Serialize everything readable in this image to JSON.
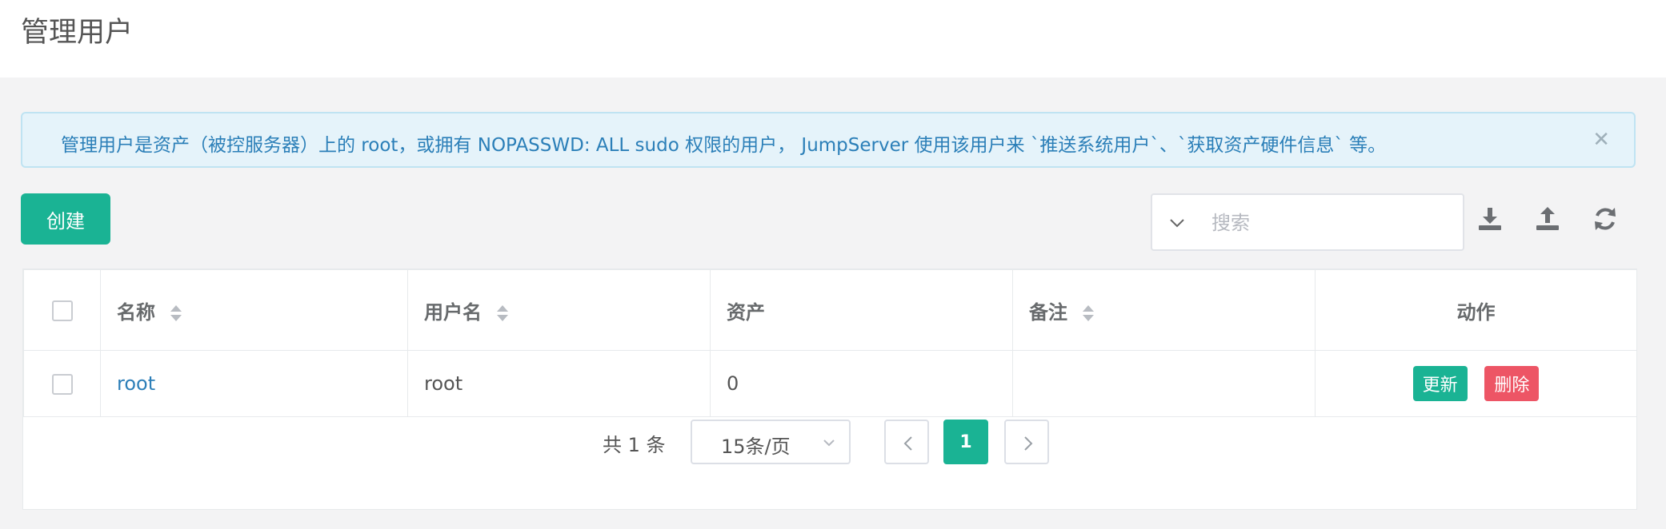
{
  "header": {
    "title": "管理用户"
  },
  "alert": {
    "text": "管理用户是资产（被控服务器）上的 root，或拥有 NOPASSWD: ALL sudo 权限的用户， JumpServer 使用该用户来 `推送系统用户`、`获取资产硬件信息` 等。",
    "close_icon": "close-icon"
  },
  "toolbar": {
    "create_label": "创建",
    "search_placeholder": "搜索",
    "icons": [
      "download-icon",
      "upload-icon",
      "refresh-icon"
    ]
  },
  "table": {
    "columns": [
      "名称",
      "用户名",
      "资产",
      "备注",
      "动作"
    ],
    "rows": [
      {
        "name": "root",
        "username": "root",
        "assets": "0",
        "comment": "",
        "update_label": "更新",
        "delete_label": "删除"
      }
    ]
  },
  "pagination": {
    "total_text": "共 1 条",
    "page_size": "15条/页",
    "current_page": "1"
  },
  "colors": {
    "primary": "#1ab394",
    "danger": "#ed5565",
    "link": "#2d7fb8",
    "alert_bg": "#e5f3fa"
  }
}
